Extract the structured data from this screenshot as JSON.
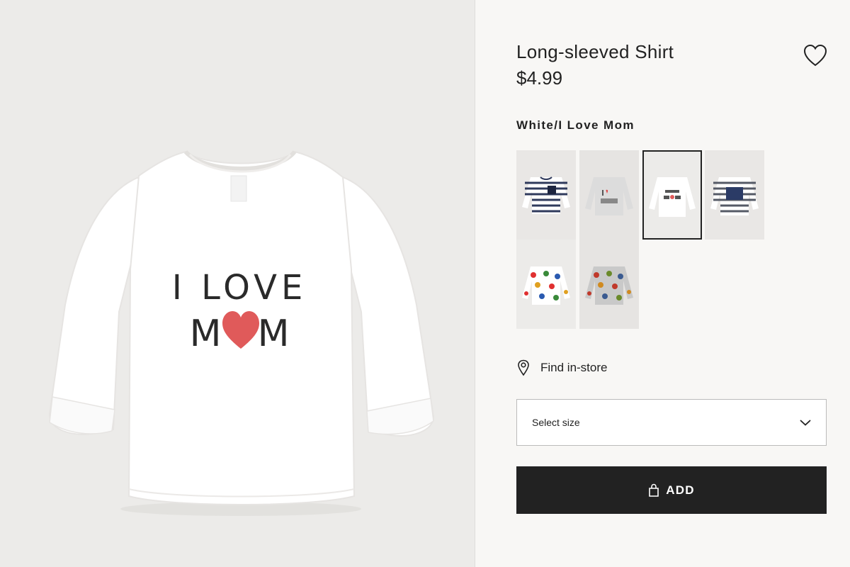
{
  "product": {
    "title": "Long-sleeved Shirt",
    "price": "$4.99",
    "color_name": "White/I Love Mom",
    "print_line1": "I LOVE",
    "print_line2_left": "M",
    "print_line2_right": "M"
  },
  "swatches": [
    {
      "name": "navy-striped-pocket",
      "selected": false
    },
    {
      "name": "grey-i-love-dad",
      "selected": false
    },
    {
      "name": "white-i-love-mom",
      "selected": true
    },
    {
      "name": "striped-little-bro",
      "selected": false
    },
    {
      "name": "white-dinosaur-print",
      "selected": false
    },
    {
      "name": "grey-dinosaur-print",
      "selected": false
    }
  ],
  "find_in_store": {
    "label": "Find in-store",
    "icon": "location-pin-icon"
  },
  "size_select": {
    "placeholder": "Select size",
    "icon": "chevron-down-icon"
  },
  "add_button": {
    "label": "ADD",
    "icon": "shopping-bag-icon"
  },
  "favorite": {
    "icon": "heart-outline-icon"
  },
  "colors": {
    "background": "#f8f7f5",
    "image_bg": "#ecebe9",
    "button": "#222222",
    "heart_red": "#e05a5a"
  }
}
